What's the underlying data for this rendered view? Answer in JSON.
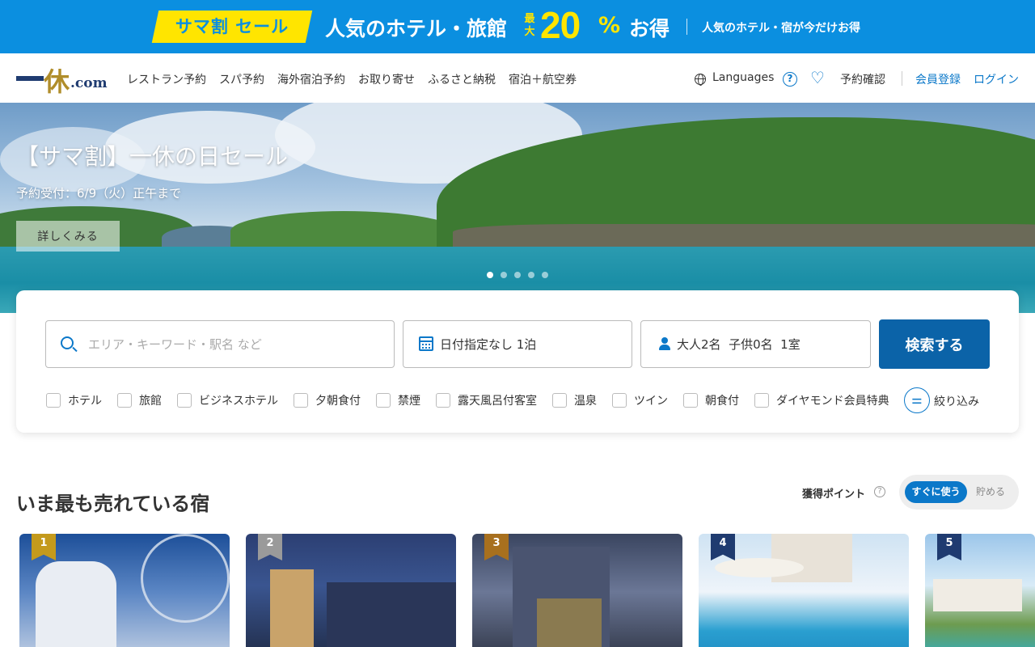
{
  "promo": {
    "tag": "サマ割 セール",
    "title": "人気のホテル・旅館",
    "small_label": "最大",
    "percent": "20",
    "percent_sign": "%",
    "otoku": "お得",
    "sub": "人気のホテル・宿が今だけお得"
  },
  "header": {
    "logo_kanji": "休",
    "logo_com": ".com",
    "nav": [
      "レストラン予約",
      "スパ予約",
      "海外宿泊予約",
      "お取り寄せ",
      "ふるさと納税",
      "宿泊＋航空券"
    ],
    "languages": "Languages",
    "help_glyph": "?",
    "heart_glyph": "♡",
    "reservations": "予約確認",
    "signup": "会員登録",
    "login": "ログイン"
  },
  "hero": {
    "title": "【サマ割】一休の日セール",
    "subtitle": "予約受付：6/9（火）正午まで",
    "button": "詳しくみる",
    "active_slide": 1,
    "slide_count": 5
  },
  "search": {
    "keyword_placeholder": "エリア・キーワード・駅名 など",
    "date_value": "日付指定なし 1泊",
    "guests_value": "大人2名  子供0名  1室",
    "submit": "検索する",
    "filters": [
      "ホテル",
      "旅館",
      "ビジネスホテル",
      "夕朝食付",
      "禁煙",
      "露天風呂付客室",
      "温泉",
      "ツイン",
      "朝食付",
      "ダイヤモンド会員特典"
    ],
    "refine_glyph": "⚌",
    "refine_label": "絞り込み"
  },
  "bestsellers": {
    "title": "いま最も売れている宿",
    "points_label": "獲得ポイント",
    "points_help": "?",
    "toggle_on": "すぐに使う",
    "toggle_off": "貯める",
    "ranks": [
      "1",
      "2",
      "3",
      "4",
      "5"
    ]
  },
  "colors": {
    "accent": "#0b78c9",
    "promo_bg": "#0b8fe0",
    "promo_yellow": "#ffe500",
    "search_button": "#0b63a8",
    "rank_gold": "#c49a1c",
    "rank_silver": "#9a9a9a",
    "rank_bronze": "#a8701e",
    "rank_navy": "#1f3b70"
  }
}
